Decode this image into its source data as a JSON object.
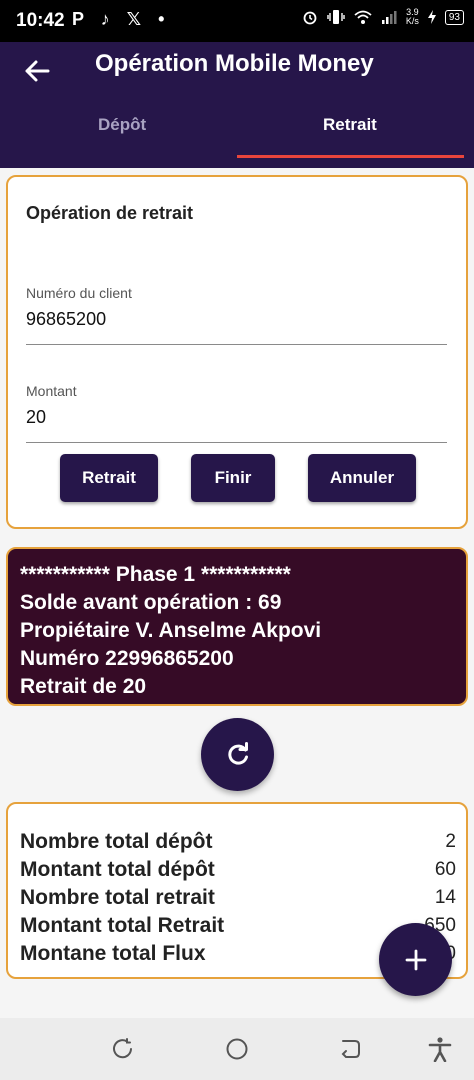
{
  "status_bar": {
    "time": "10:42",
    "left_icons": "P ♪ 𝕏 •",
    "speed_value": "3.9",
    "speed_unit": "K/s",
    "battery": "93"
  },
  "app_bar": {
    "title": "Opération Mobile Money",
    "tabs": [
      {
        "label": "Dépôt",
        "selected": false
      },
      {
        "label": "Retrait",
        "selected": true
      }
    ],
    "accent_color": "#e8453c",
    "background_color": "#26164a"
  },
  "form": {
    "title": "Opération de retrait",
    "client_number": {
      "label": "Numéro du client",
      "value": "96865200"
    },
    "amount": {
      "label": "Montant",
      "value": "20"
    },
    "buttons": {
      "retrait": "Retrait",
      "finir": "Finir",
      "annuler": "Annuler"
    }
  },
  "log": {
    "lines": [
      "*********** Phase 1 ***********",
      "Solde avant opération : 69",
      "Propiétaire V. Anselme Akpovi",
      "Numéro 22996865200",
      "Retrait de 20"
    ],
    "background_color": "#360b26"
  },
  "totals": {
    "rows": [
      {
        "label": "Nombre total dépôt",
        "value": "2"
      },
      {
        "label": "Montant total dépôt",
        "value": "60"
      },
      {
        "label": "Nombre total retrait",
        "value": "14"
      },
      {
        "label": "Montant total Retrait",
        "value": "650"
      },
      {
        "label": "Montane total Flux",
        "value": "0"
      }
    ]
  },
  "icons": {
    "back": "arrow-left-icon",
    "refresh": "refresh-icon",
    "add": "plus-icon",
    "nav": [
      "recents-icon",
      "home-icon",
      "back-nav-icon",
      "accessibility-icon"
    ]
  },
  "border_color": "#e6a23c"
}
